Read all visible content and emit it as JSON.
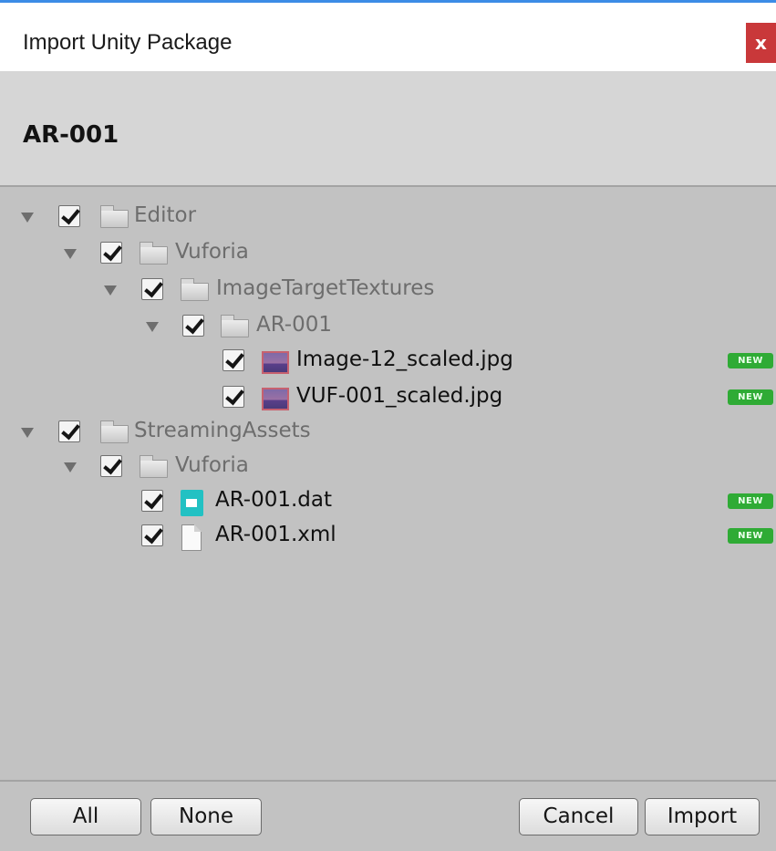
{
  "window": {
    "title": "Import Unity Package",
    "close_label": "x",
    "accent_color": "#3c8ce6",
    "close_color": "#c9383a"
  },
  "package": {
    "name": "AR-001"
  },
  "tree": {
    "items": [
      {
        "label": "Editor",
        "type": "folder",
        "checked": true,
        "expanded": true,
        "new": false
      },
      {
        "label": "Vuforia",
        "type": "folder",
        "checked": true,
        "expanded": true,
        "new": false
      },
      {
        "label": "ImageTargetTextures",
        "type": "folder",
        "checked": true,
        "expanded": true,
        "new": false
      },
      {
        "label": "AR-001",
        "type": "folder",
        "checked": true,
        "expanded": true,
        "new": false
      },
      {
        "label": "Image-12_scaled.jpg",
        "type": "image",
        "checked": true,
        "new": true,
        "badge": "NEW"
      },
      {
        "label": "VUF-001_scaled.jpg",
        "type": "image",
        "checked": true,
        "new": true,
        "badge": "NEW"
      },
      {
        "label": "StreamingAssets",
        "type": "folder",
        "checked": true,
        "expanded": true,
        "new": false
      },
      {
        "label": "Vuforia",
        "type": "folder",
        "checked": true,
        "expanded": true,
        "new": false
      },
      {
        "label": "AR-001.dat",
        "type": "dat",
        "checked": true,
        "new": true,
        "badge": "NEW"
      },
      {
        "label": "AR-001.xml",
        "type": "file",
        "checked": true,
        "new": true,
        "badge": "NEW"
      }
    ]
  },
  "footer": {
    "all_label": "All",
    "none_label": "None",
    "cancel_label": "Cancel",
    "import_label": "Import"
  },
  "colors": {
    "new_badge": "#2fab35",
    "background": "#c2c2c2"
  }
}
